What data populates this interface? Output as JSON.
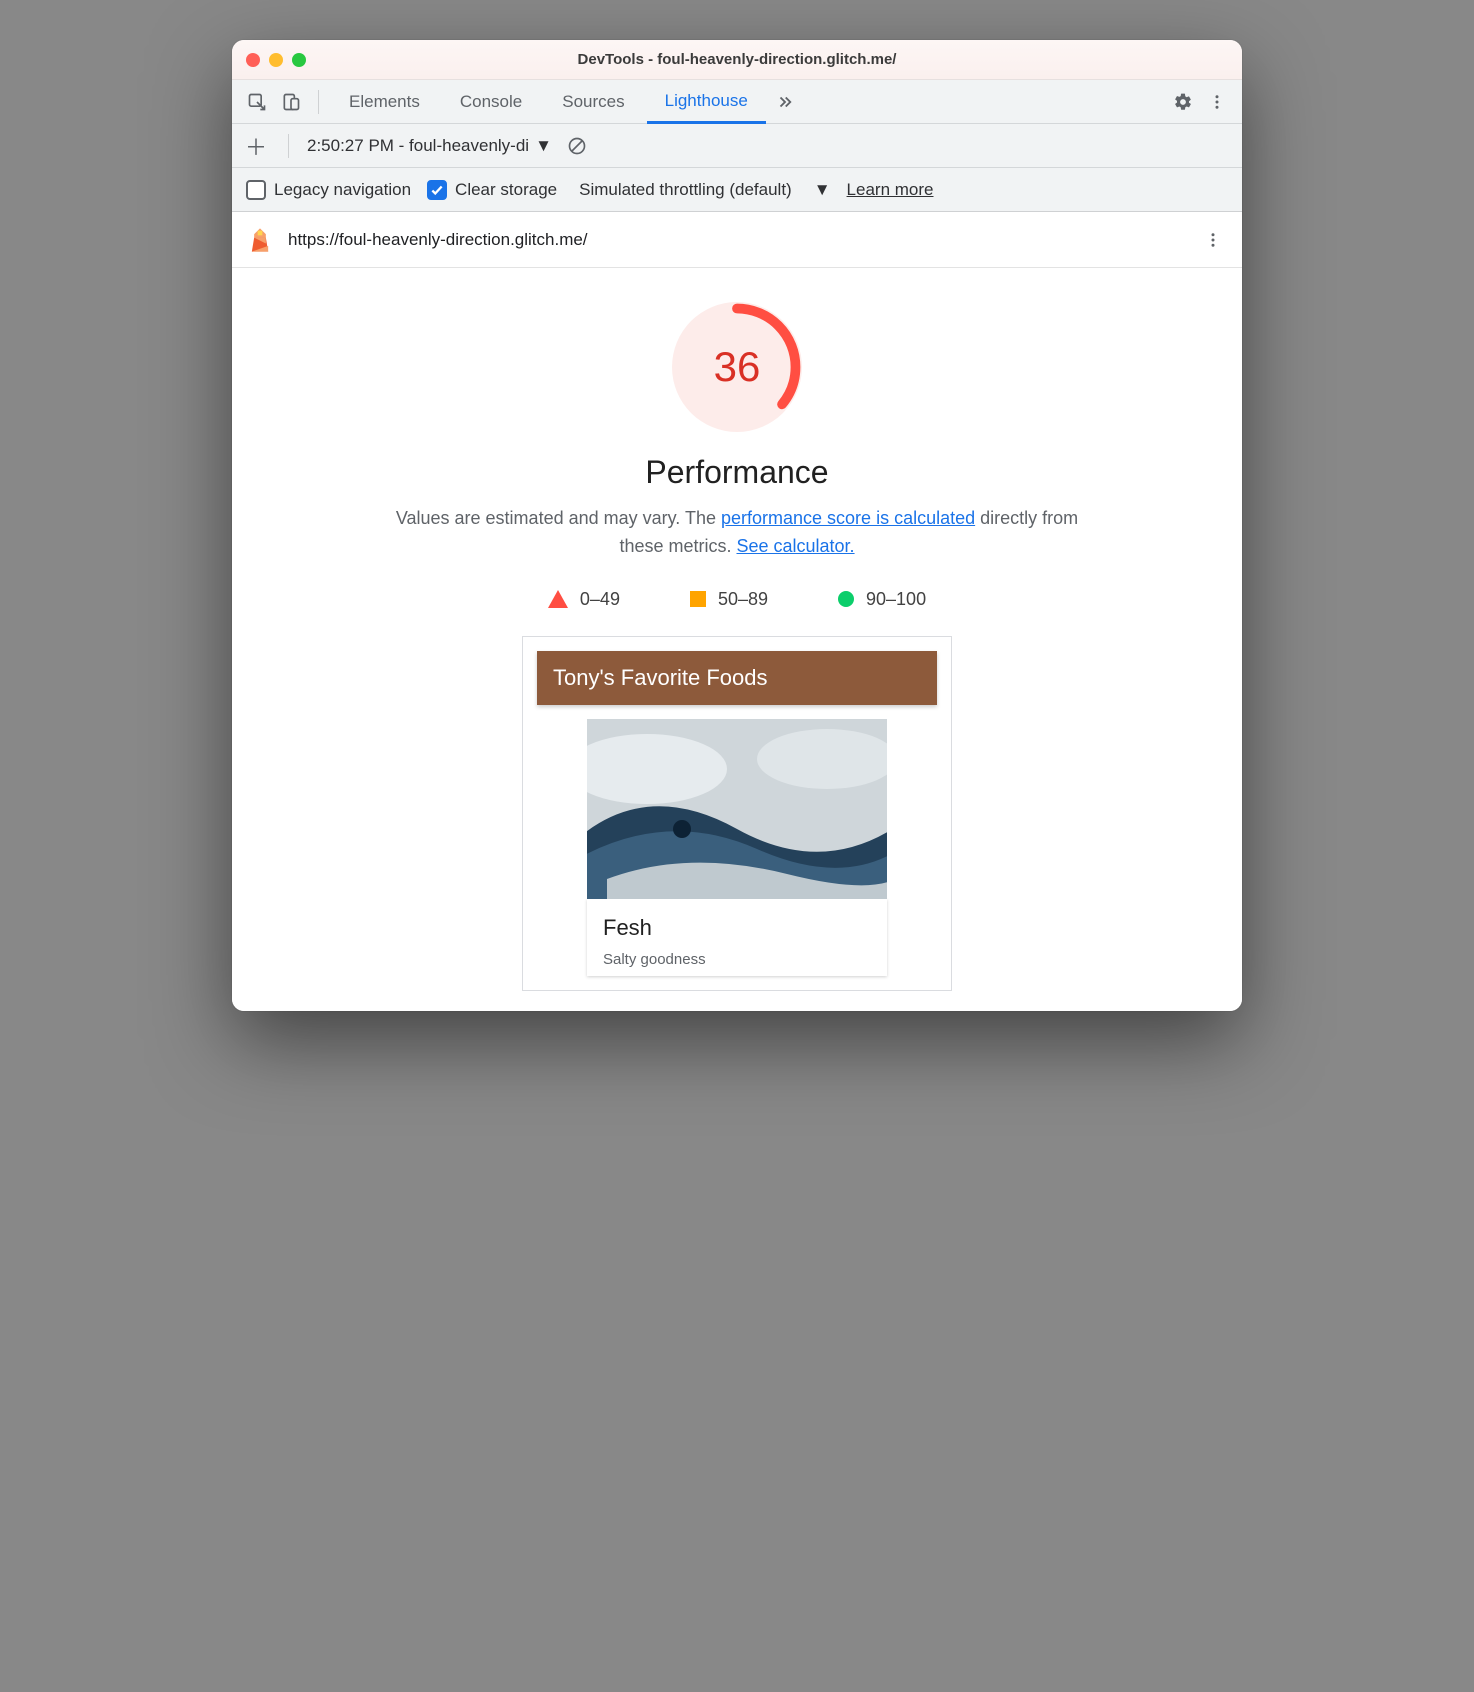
{
  "window": {
    "title": "DevTools - foul-heavenly-direction.glitch.me/"
  },
  "tabs": {
    "elements": "Elements",
    "console": "Console",
    "sources": "Sources",
    "lighthouse": "Lighthouse"
  },
  "subbar": {
    "report_label": "2:50:27 PM - foul-heavenly-di"
  },
  "options": {
    "legacy_nav_label": "Legacy navigation",
    "legacy_nav_checked": false,
    "clear_storage_label": "Clear storage",
    "clear_storage_checked": true,
    "throttle_label": "Simulated throttling (default)",
    "learn_more": "Learn more"
  },
  "url": "https://foul-heavenly-direction.glitch.me/",
  "report": {
    "score": "36",
    "category": "Performance",
    "blurb_prefix": "Values are estimated and may vary. The ",
    "blurb_link1": "performance score is calculated",
    "blurb_mid": " directly from these metrics. ",
    "blurb_link2": "See calculator.",
    "legend": {
      "fail": "0–49",
      "avg": "50–89",
      "pass": "90–100"
    }
  },
  "preview": {
    "header": "Tony's Favorite Foods",
    "item_title": "Fesh",
    "item_sub": "Salty goodness"
  },
  "colors": {
    "fail": "#ff4e42",
    "avg": "#ffa400",
    "pass": "#0cce6b",
    "link": "#1a73e8"
  }
}
